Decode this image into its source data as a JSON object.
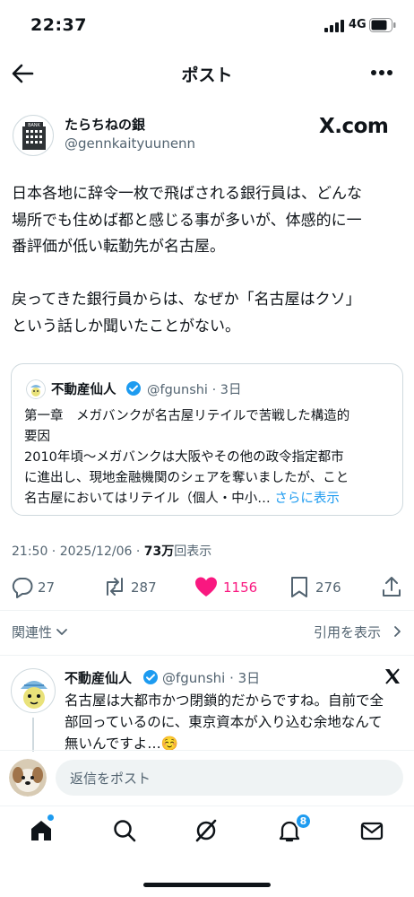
{
  "status_bar": {
    "time": "22:37",
    "network": "4G"
  },
  "header": {
    "title": "ポスト"
  },
  "post": {
    "author_name": "たらちねの銀",
    "author_handle": "@gennkaityuunenn",
    "watermark": "X.com",
    "avatar_sign": "BANK",
    "paragraph1": "日本各地に辞令一枚で飛ばされる銀行員は、どんな\n場所でも住めば都と感じる事が多いが、体感的に一\n番評価が低い転勤先が名古屋。",
    "paragraph2": "戻ってきた銀行員からは、なぜか「名古屋はクソ」\nという話しか聞いたことがない。",
    "quote": {
      "name": "不動産仙人",
      "handle": "@fgunshi · 3日",
      "line1": "第一章　メガバンクが名古屋リテイルで苦戦した構造的",
      "line2": "要因",
      "line3": "2010年頃〜メガバンクは大阪やその他の政令指定都市",
      "line4": "に進出し、現地金融機関のシェアを奪いましたが、こと",
      "line5": "名古屋においてはリテイル（個人・中小… ",
      "more": "さらに表示"
    },
    "time": "21:50 · 2025/12/06 · ",
    "views_number": "73万",
    "views_label": "回表示",
    "replies": "27",
    "retweets": "287",
    "likes": "1156",
    "bookmarks": "276"
  },
  "filters": {
    "related": "関連性",
    "quotes": "引用を表示"
  },
  "reply": {
    "name": "不動産仙人",
    "handle": "@fgunshi · 3日",
    "line1": "名古屋は大都市かつ閉鎖的だからですね。自前で全",
    "line2": "部回っているのに、東京資本が入り込む余地なんて",
    "line3": "無いんですよ…☺️"
  },
  "reply_bar": {
    "placeholder": "返信をポスト"
  },
  "tab_bar": {
    "notification_count": "8"
  },
  "colors": {
    "accent": "#1d9bf0",
    "like": "#f91880",
    "text": "#0f1419",
    "muted": "#536471"
  }
}
